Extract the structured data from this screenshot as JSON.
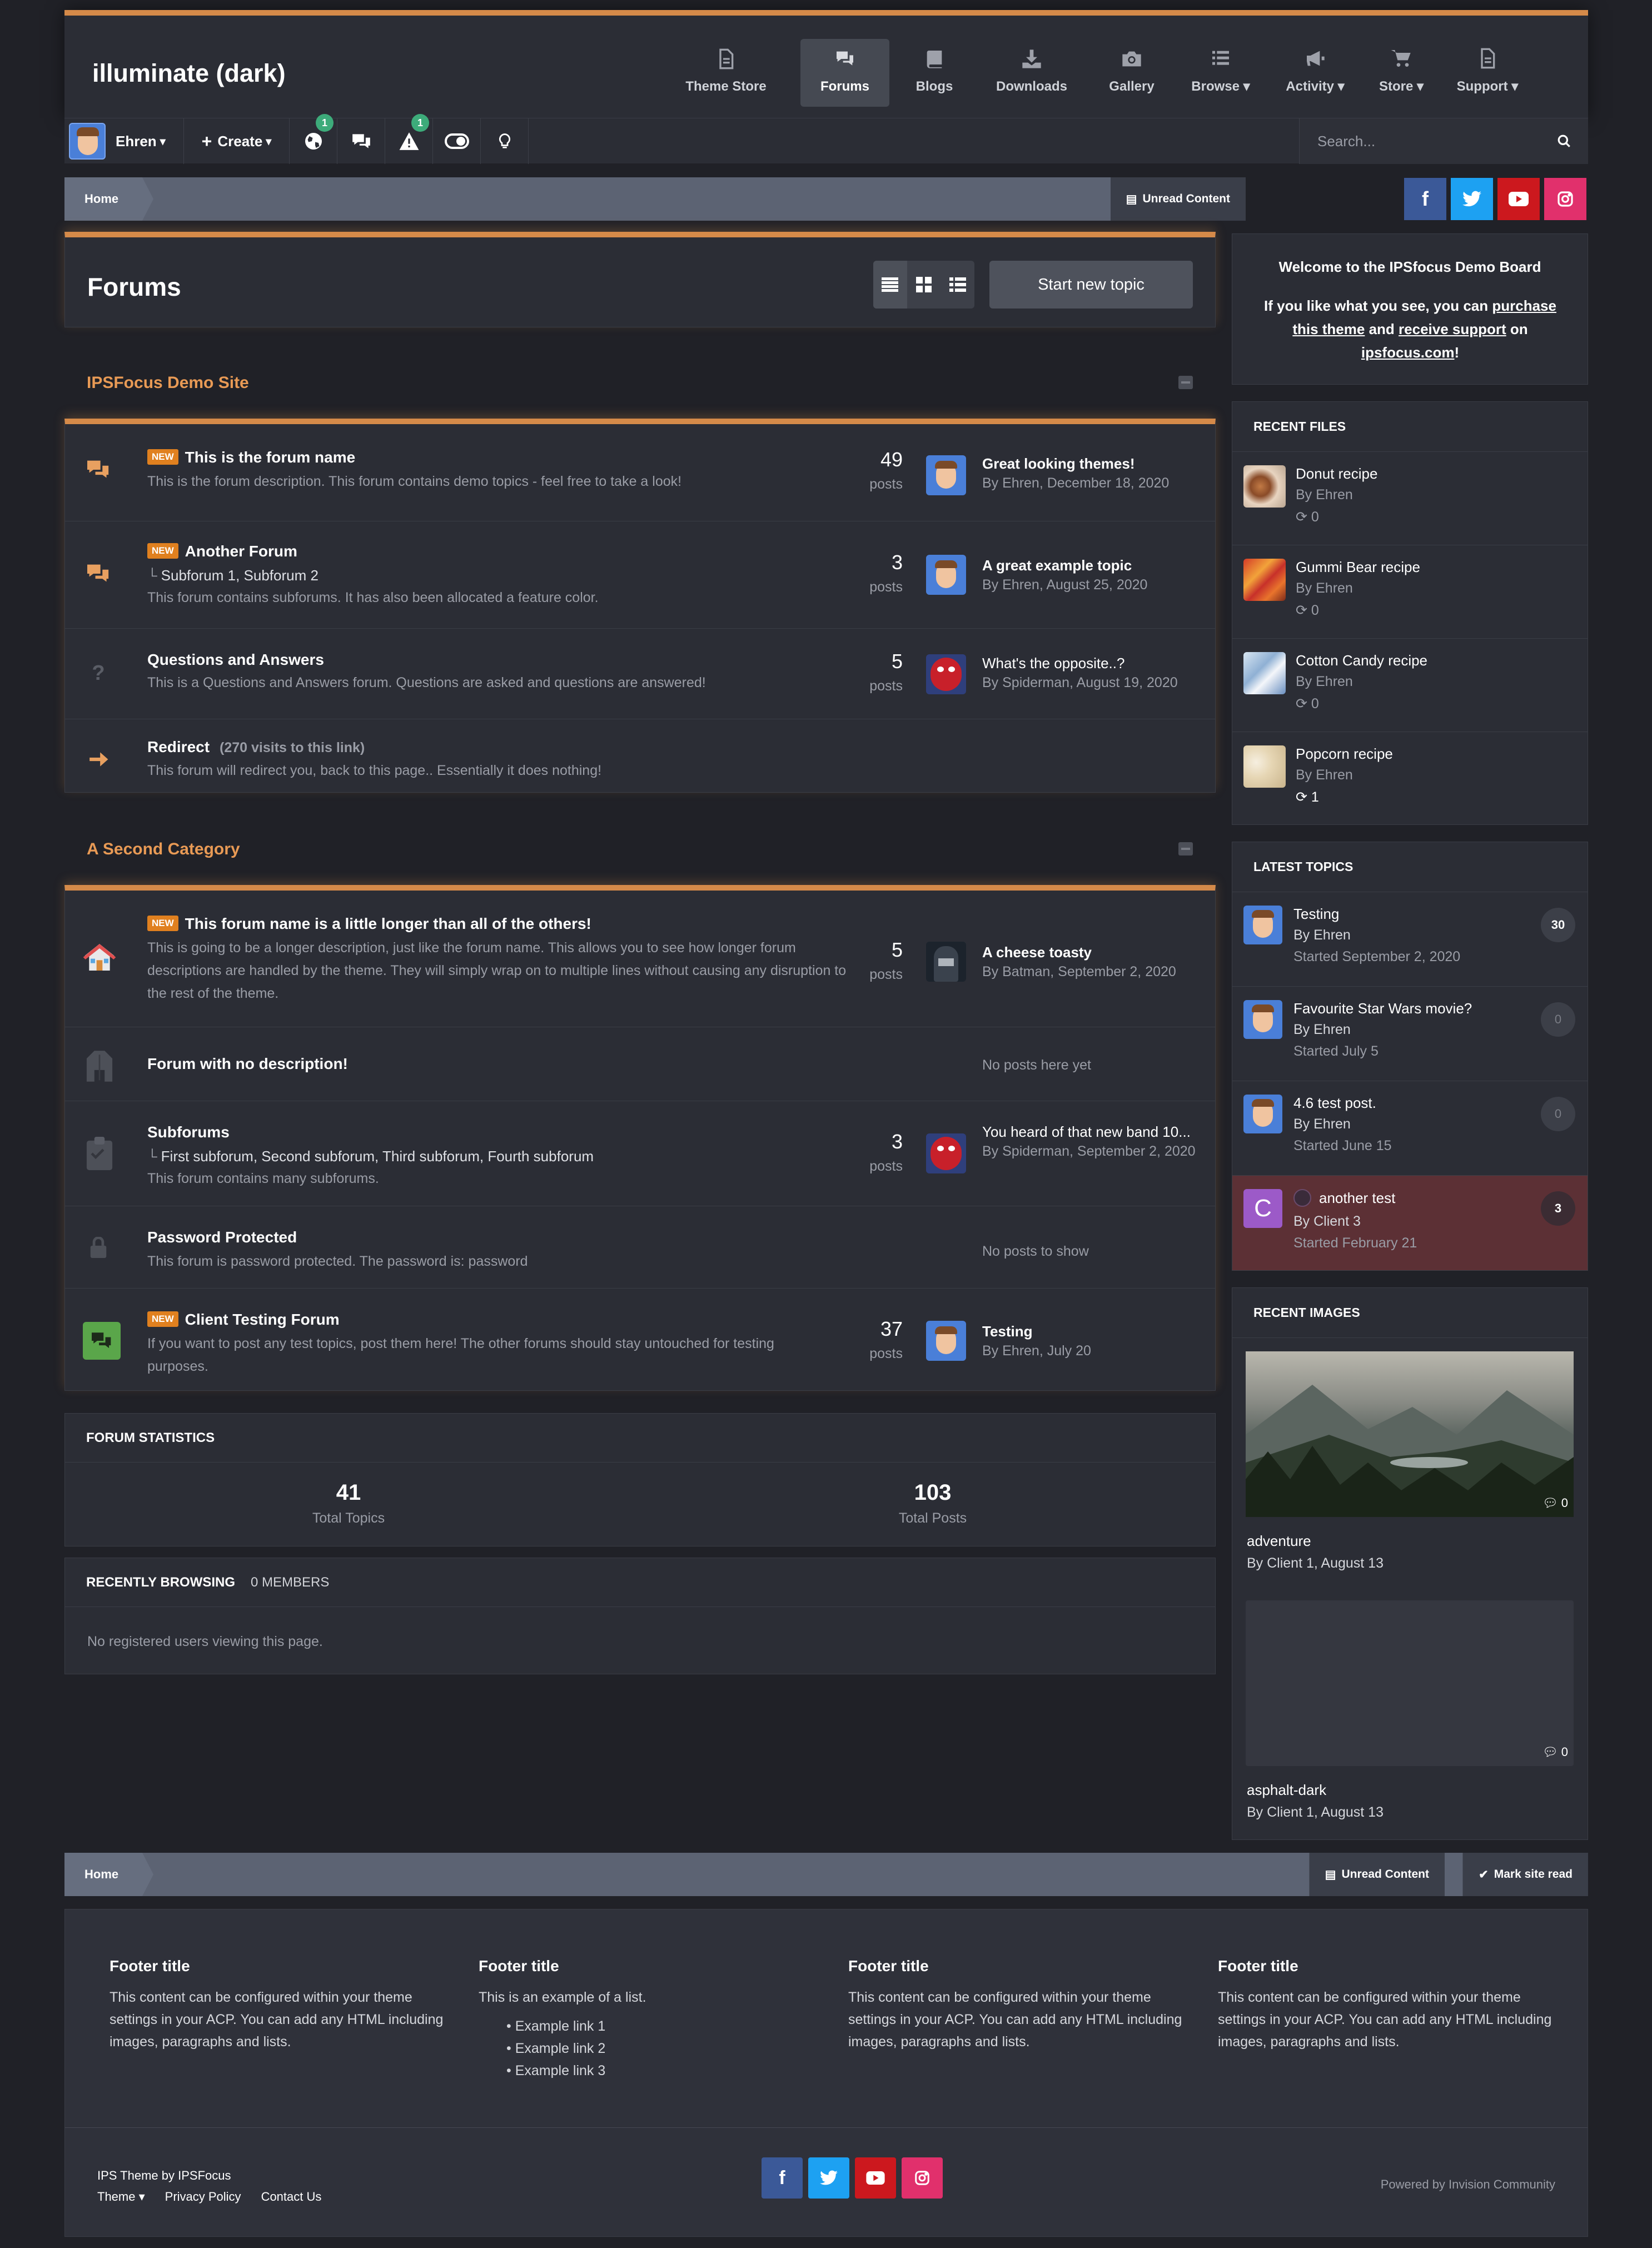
{
  "header": {
    "site_title": "illuminate (dark)",
    "nav": [
      {
        "label": "Theme Store",
        "icon": "document-icon"
      },
      {
        "label": "Forums",
        "icon": "chat-bubbles-icon",
        "active": true
      },
      {
        "label": "Blogs",
        "icon": "book-icon"
      },
      {
        "label": "Downloads",
        "icon": "download-icon"
      },
      {
        "label": "Gallery",
        "icon": "camera-icon"
      },
      {
        "label": "Browse",
        "icon": "list-icon",
        "dropdown": true
      },
      {
        "label": "Activity",
        "icon": "megaphone-icon",
        "dropdown": true
      },
      {
        "label": "Store",
        "icon": "cart-icon",
        "dropdown": true
      },
      {
        "label": "Support",
        "icon": "document-icon",
        "dropdown": true
      }
    ]
  },
  "userbar": {
    "username": "Ehren",
    "create_label": "Create",
    "notifications_badge": "1",
    "reports_badge": "1",
    "search_placeholder": "Search..."
  },
  "breadcrumb": {
    "home": "Home",
    "unread": "Unread Content",
    "mark_read": "Mark site read"
  },
  "page": {
    "title": "Forums",
    "start_topic": "Start new topic"
  },
  "categories": [
    {
      "title": "IPSFocus Demo Site",
      "forums": [
        {
          "name": "This is the forum name",
          "new": true,
          "desc": "This is the forum description. This forum contains demo topics - feel free to take a look!",
          "count": "49",
          "count_label": "posts",
          "last_title": "Great looking themes!",
          "last_by": "By Ehren, December 18, 2020"
        },
        {
          "name": "Another Forum",
          "new": true,
          "subforums": "Subforum 1,   Subforum 2",
          "desc": "This forum contains subforums. It has also been allocated a feature color.",
          "count": "3",
          "count_label": "posts",
          "last_title": "A great example topic",
          "last_by": "By Ehren, August 25, 2020"
        },
        {
          "name": "Questions and Answers",
          "desc": "This is a Questions and Answers forum. Questions are asked and questions are answered!",
          "count": "5",
          "count_label": "posts",
          "last_title": "What's the opposite..?",
          "last_by": "By Spiderman, August 19, 2020"
        },
        {
          "name": "Redirect",
          "extra": "(270 visits to this link)",
          "desc": "This forum will redirect you, back to this page.. Essentially it does nothing!"
        }
      ]
    },
    {
      "title": "A Second Category",
      "forums": [
        {
          "name": "This forum name is a little longer than all of the others!",
          "new": true,
          "desc": "This is going to be a longer description, just like the forum name. This allows you to see how longer forum descriptions are handled by the theme. They will simply wrap on to multiple lines without causing any disruption to the rest of the theme.",
          "count": "5",
          "count_label": "posts",
          "last_title": "A cheese toasty",
          "last_by": "By Batman, September 2, 2020"
        },
        {
          "name": "Forum with no description!",
          "empty": "No posts here yet"
        },
        {
          "name": "Subforums",
          "subforums": "First subforum,   Second subforum,   Third subforum,   Fourth subforum",
          "desc": "This forum contains many subforums.",
          "count": "3",
          "count_label": "posts",
          "last_title": "You heard of that new band 10...",
          "last_by": "By Spiderman, September 2, 2020"
        },
        {
          "name": "Password Protected",
          "desc": "This forum is password protected. The password is: password",
          "empty": "No posts to show"
        },
        {
          "name": "Client Testing Forum",
          "new": true,
          "desc": "If you want to post any test topics, post them here! The other forums should stay untouched for testing purposes.",
          "count": "37",
          "count_label": "posts",
          "last_title": "Testing",
          "last_by": "By Ehren, July 20"
        }
      ]
    }
  ],
  "new_label": "NEW",
  "stats": {
    "title": "FORUM STATISTICS",
    "topics": "41",
    "topics_label": "Total Topics",
    "posts": "103",
    "posts_label": "Total Posts"
  },
  "browsing": {
    "title": "RECENTLY BROWSING",
    "members": "0 MEMBERS",
    "empty": "No registered users viewing this page."
  },
  "sidebar": {
    "welcome": {
      "title": "Welcome to the IPSfocus Demo Board",
      "l1": "If you like what you see, you can",
      "purchase": "purchase this theme",
      "and": "and",
      "support": "receive support",
      "on": "on",
      "site": "ipsfocus.com",
      "bang": "!"
    },
    "recent_files": {
      "title": "RECENT FILES",
      "items": [
        {
          "name": "Donut recipe",
          "by": "By Ehren",
          "count": "0"
        },
        {
          "name": "Gummi Bear recipe",
          "by": "By Ehren",
          "count": "0"
        },
        {
          "name": "Cotton Candy recipe",
          "by": "By Ehren",
          "count": "0"
        },
        {
          "name": "Popcorn recipe",
          "by": "By Ehren",
          "count": "1"
        }
      ]
    },
    "latest_topics": {
      "title": "LATEST TOPICS",
      "items": [
        {
          "name": "Testing",
          "by": "By Ehren",
          "started": "Started September 2, 2020",
          "replies": "30"
        },
        {
          "name": "Favourite Star Wars movie?",
          "by": "By Ehren",
          "started": "Started July 5",
          "replies": "0"
        },
        {
          "name": "4.6 test post.",
          "by": "By Ehren",
          "started": "Started June 15",
          "replies": "0"
        },
        {
          "name": "another test",
          "by": "By Client 3",
          "started": "Started February 21",
          "replies": "3",
          "avatar_letter": "C",
          "highlight": true
        }
      ]
    },
    "recent_images": {
      "title": "RECENT IMAGES",
      "items": [
        {
          "name": "adventure",
          "by": "By Client 1, August 13",
          "comments": "0"
        },
        {
          "name": "asphalt-dark",
          "by": "By Client 1, August 13",
          "comments": "0"
        }
      ]
    }
  },
  "footer": {
    "cols": [
      {
        "title": "Footer title",
        "text": "This content can be configured within your theme settings in your ACP. You can add any HTML including images, paragraphs and lists."
      },
      {
        "title": "Footer title",
        "text": "This is an example of a list.",
        "list": [
          "Example link 1",
          "Example link 2",
          "Example link 3"
        ]
      },
      {
        "title": "Footer title",
        "text": "This content can be configured within your theme settings in your ACP. You can add any HTML including images, paragraphs and lists."
      },
      {
        "title": "Footer title",
        "text": "This content can be configured within your theme settings in your ACP. You can add any HTML including images, paragraphs and lists."
      }
    ],
    "credit": "IPS Theme by IPSFocus",
    "theme": "Theme",
    "privacy": "Privacy Policy",
    "contact": "Contact Us",
    "powered": "Powered by Invision Community"
  },
  "colors": {
    "accent": "#d58a49",
    "new_badge": "#e0801f",
    "facebook": "#3b5998",
    "twitter": "#1da1f2",
    "youtube": "#cc181e",
    "instagram": "#e1306c",
    "highlight_row": "#5c3035"
  }
}
